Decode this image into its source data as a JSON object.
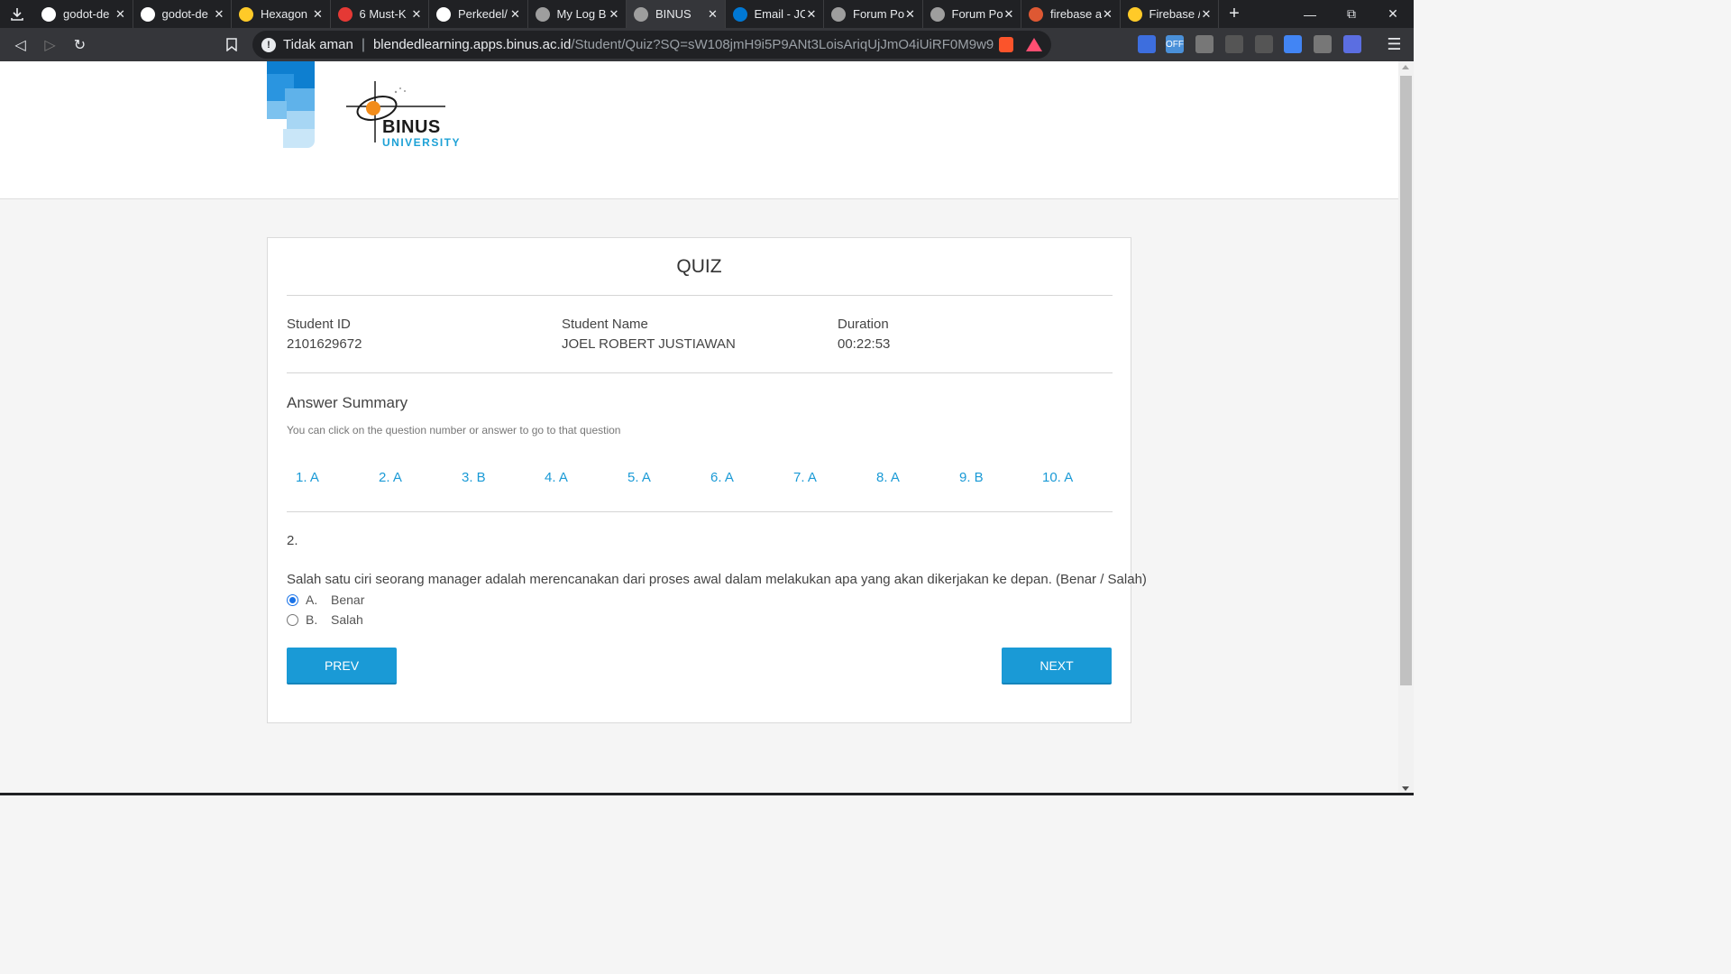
{
  "browser": {
    "tabs": [
      {
        "title": "godot-de",
        "icon": "github-icon",
        "color": "#ffffff"
      },
      {
        "title": "godot-de",
        "icon": "github-icon",
        "color": "#ffffff"
      },
      {
        "title": "Hexagon",
        "icon": "firebase-icon",
        "color": "#ffca28"
      },
      {
        "title": "6 Must-K",
        "icon": "pin-icon",
        "color": "#e53935"
      },
      {
        "title": "Perkedel/",
        "icon": "github-icon",
        "color": "#ffffff"
      },
      {
        "title": "My Log B",
        "icon": "binus-icon",
        "color": "#9e9e9e"
      },
      {
        "title": "BINUS",
        "icon": "binus-icon",
        "color": "#9e9e9e"
      },
      {
        "title": "Email - JC",
        "icon": "outlook-icon",
        "color": "#0078d4"
      },
      {
        "title": "Forum Po",
        "icon": "binus-icon",
        "color": "#9e9e9e"
      },
      {
        "title": "Forum Po",
        "icon": "binus-icon",
        "color": "#9e9e9e"
      },
      {
        "title": "firebase a",
        "icon": "duckduckgo-icon",
        "color": "#de5833"
      },
      {
        "title": "Firebase /",
        "icon": "firebase-icon",
        "color": "#ffca28"
      }
    ],
    "active_tab_index": 6,
    "security_label": "Tidak aman",
    "url_host": "blendedlearning.apps.binus.ac.id",
    "url_path": "/Student/Quiz?SQ=sW108jmH9i5P9ANt3LoisAriqUjJmO4iUiRF0M9w9XT6...",
    "extensions": [
      {
        "name": "shield-ext-icon",
        "color": "#3d6ede"
      },
      {
        "name": "off-ext-icon",
        "color": "#4a90d9",
        "label": "OFF"
      },
      {
        "name": "bulb-ext-icon",
        "color": "#777777"
      },
      {
        "name": "omega-ext-icon",
        "color": "#555555"
      },
      {
        "name": "clock-ext-icon",
        "color": "#555555"
      },
      {
        "name": "translate-ext-icon",
        "color": "#4285f4"
      },
      {
        "name": "keyboard-ext-icon",
        "color": "#777777"
      },
      {
        "name": "cursor-ext-icon",
        "color": "#5b6ee1"
      }
    ]
  },
  "logo": {
    "name": "BINUS",
    "sub": "UNIVERSITY"
  },
  "quiz": {
    "title": "QUIZ",
    "student_id_label": "Student ID",
    "student_id": "2101629672",
    "student_name_label": "Student Name",
    "student_name": "JOEL ROBERT JUSTIAWAN",
    "duration_label": "Duration",
    "duration": "00:22:53",
    "summary_title": "Answer Summary",
    "summary_hint": "You can click on the question number or answer to go to that question",
    "answers": [
      "1. A",
      "2. A",
      "3. B",
      "4. A",
      "5. A",
      "6. A",
      "7. A",
      "8. A",
      "9. B",
      "10. A"
    ],
    "question_number": "2.",
    "question_text": "Salah satu ciri seorang manager adalah merencanakan dari proses awal dalam melakukan apa yang akan dikerjakan ke depan. (Benar / Salah)",
    "options": [
      {
        "letter": "A.",
        "text": "Benar",
        "checked": true
      },
      {
        "letter": "B.",
        "text": "Salah",
        "checked": false
      }
    ],
    "prev_label": "PREV",
    "next_label": "NEXT"
  },
  "colors": {
    "accent": "#1a9ad6",
    "brand_blue": "#1da1d6"
  }
}
